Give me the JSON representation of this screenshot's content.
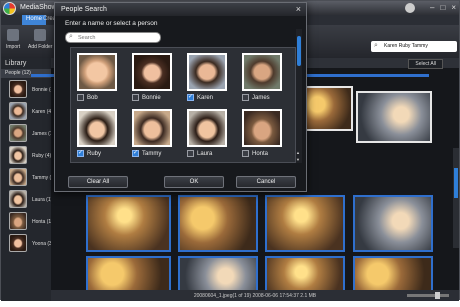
{
  "app": {
    "title": "MediaShow - Ph",
    "menu": {
      "home": "Home",
      "create": "Creat"
    },
    "toolbar": {
      "import": "Import",
      "add_folder": "Add Folder"
    },
    "people_search_value": "Karen Ruby Tammy",
    "library": {
      "heading": "Library",
      "people_label": "People (12)",
      "people": [
        {
          "label": "Bonnie (4)",
          "face": "f2"
        },
        {
          "label": "Karen (4)",
          "face": "f3"
        },
        {
          "label": "James (1)",
          "face": "f4"
        },
        {
          "label": "Ruby (4)",
          "face": "f5"
        },
        {
          "label": "Tammy (3)",
          "face": "f6"
        },
        {
          "label": "Laura (1)",
          "face": "f7"
        },
        {
          "label": "Honta (1)",
          "face": "f8"
        },
        {
          "label": "Yoona (3)",
          "face": "f2"
        }
      ]
    },
    "select_all": "Select All",
    "status": "20080604_1.jpeg(1 of 19) 2008-06-06 17:54:37 2.1 MB",
    "zoom_level": 0.75
  },
  "dialog": {
    "title": "People Search",
    "prompt": "Enter a name or select a person",
    "search_placeholder": "Search",
    "people": [
      {
        "name": "Bob",
        "checked": false,
        "face": "f1"
      },
      {
        "name": "Bonnie",
        "checked": false,
        "face": "f2"
      },
      {
        "name": "Karen",
        "checked": true,
        "face": "f3"
      },
      {
        "name": "James",
        "checked": false,
        "face": "f4"
      },
      {
        "name": "Ruby",
        "checked": true,
        "face": "f5"
      },
      {
        "name": "Tammy",
        "checked": true,
        "face": "f6"
      },
      {
        "name": "Laura",
        "checked": false,
        "face": "f7"
      },
      {
        "name": "Honta",
        "checked": false,
        "face": "f8"
      }
    ],
    "buttons": {
      "clear_all": "Clear All",
      "ok": "OK",
      "cancel": "Cancel"
    },
    "scroll_position": 0.05
  },
  "colors": {
    "accent": "#2f7fd8",
    "dialog_bg": "#17191d",
    "panel_bg": "#2c2f35",
    "app_bg": "#1b1d22"
  },
  "icons": {
    "close": "×",
    "search": "⌕",
    "arrow_up": "▲",
    "arrow_down": "▼"
  }
}
